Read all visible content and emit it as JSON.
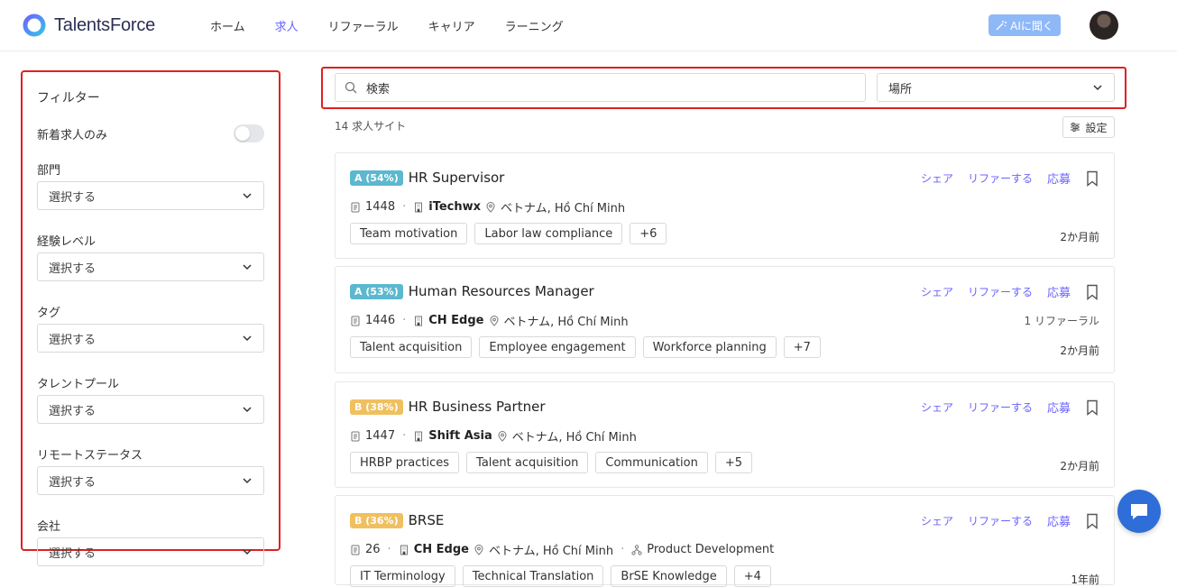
{
  "brand": {
    "name": "TalentsForce"
  },
  "nav": [
    {
      "label": "ホーム",
      "active": false
    },
    {
      "label": "求人",
      "active": true
    },
    {
      "label": "リファーラル",
      "active": false
    },
    {
      "label": "キャリア",
      "active": false
    },
    {
      "label": "ラーニング",
      "active": false
    }
  ],
  "ai_button": "AIに聞く",
  "filters": {
    "title": "フィルター",
    "new_only_label": "新着求人のみ",
    "new_only": false,
    "placeholder": "選択する",
    "fields": [
      "部門",
      "経験レベル",
      "タグ",
      "タレントプール",
      "リモートステータス",
      "会社"
    ]
  },
  "search": {
    "placeholder": "検索",
    "location": "場所"
  },
  "result_count": "14 求人サイト",
  "settings_label": "設定",
  "actions": {
    "share": "シェア",
    "refer": "リファーする",
    "apply": "応募"
  },
  "jobs": [
    {
      "badge": "A (54%)",
      "grade": "a",
      "title": "HR Supervisor",
      "id": "1448",
      "company": "iTechwx",
      "location": "ベトナム, Hồ Chí Minh",
      "tags": [
        "Team motivation",
        "Labor law compliance",
        "+6"
      ],
      "ago": "2か月前",
      "referral": ""
    },
    {
      "badge": "A (53%)",
      "grade": "a",
      "title": "Human Resources Manager",
      "id": "1446",
      "company": "CH Edge",
      "location": "ベトナム, Hồ Chí Minh",
      "tags": [
        "Talent acquisition",
        "Employee engagement",
        "Workforce planning",
        "+7"
      ],
      "ago": "2か月前",
      "referral": "1 リファーラル"
    },
    {
      "badge": "B (38%)",
      "grade": "b",
      "title": "HR Business Partner",
      "id": "1447",
      "company": "Shift Asia",
      "location": "ベトナム, Hồ Chí Minh",
      "tags": [
        "HRBP practices",
        "Talent acquisition",
        "Communication",
        "+5"
      ],
      "ago": "2か月前",
      "referral": ""
    },
    {
      "badge": "B (36%)",
      "grade": "b",
      "title": "BRSE",
      "id": "26",
      "company": "CH Edge",
      "location": "ベトナム, Hồ Chí Minh",
      "department": "Product Development",
      "tags": [
        "IT Terminology",
        "Technical Translation",
        "BrSE Knowledge",
        "+4"
      ],
      "ago": "1年前",
      "referral": ""
    }
  ]
}
